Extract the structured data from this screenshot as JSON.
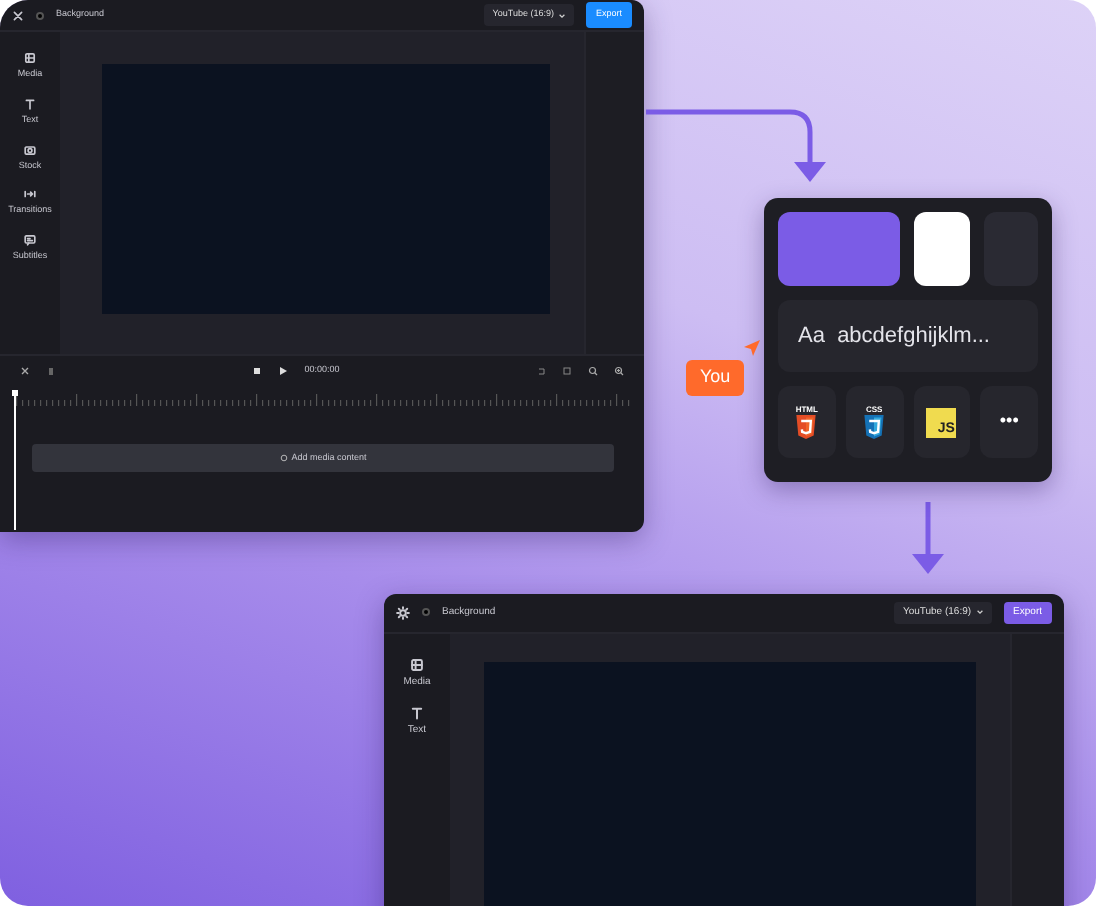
{
  "editors": [
    {
      "title": "Background",
      "aspect": "YouTube (16:9)",
      "export": "Export",
      "color": "#1a8cff",
      "kind": "timeline",
      "sidebar": [
        {
          "kind": "media",
          "label": "Media"
        },
        {
          "kind": "text",
          "label": "Text"
        },
        {
          "kind": "stock",
          "label": "Stock"
        },
        {
          "kind": "transitions",
          "label": "Transitions"
        },
        {
          "kind": "subtitles",
          "label": "Subtitles"
        }
      ],
      "timecode": "00:00:00",
      "add_media": "Add media content"
    },
    {
      "title": "Background",
      "aspect": "YouTube (16:9)",
      "export": "Export",
      "color": "#7b5ce6",
      "kind": "compact",
      "sidebar": [
        {
          "kind": "media",
          "label": "Media"
        },
        {
          "kind": "text",
          "label": "Text"
        }
      ]
    }
  ],
  "style_panel": {
    "swatches": [
      {
        "color": "#7b5ce6"
      },
      {
        "color": "#ffffff"
      },
      {
        "color": "#2a2a33"
      }
    ],
    "font_sample": "Aa",
    "font_alphabet": "abcdefghijklm...",
    "techs": [
      {
        "kind": "html",
        "label": "HTML"
      },
      {
        "kind": "css",
        "label": "CSS"
      },
      {
        "kind": "js",
        "label": "JS"
      },
      {
        "kind": "more",
        "label": "•••"
      }
    ]
  },
  "cursor_tag": "You"
}
